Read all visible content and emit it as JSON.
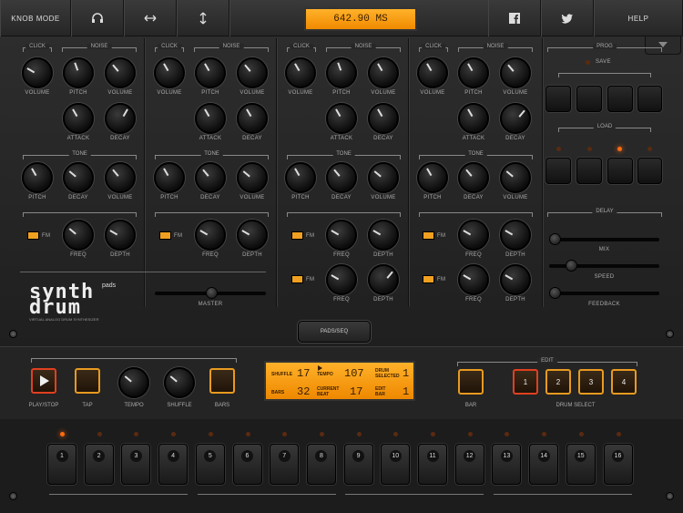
{
  "topbar": {
    "knob_mode": "KNOB MODE",
    "display": "642.90 MS",
    "help": "HELP"
  },
  "drum": {
    "click": "CLICK",
    "noise": "NOISE",
    "tone": "TONE",
    "volume": "VOLUME",
    "pitch": "PITCH",
    "attack": "ATTACK",
    "decay": "DECAY",
    "freq": "FREQ",
    "depth": "DEPTH",
    "fm": "FM"
  },
  "logo": {
    "brand_line1": "synth",
    "brand_line2": "drum",
    "pads": "pads",
    "tagline": "VIRTUAL ANALOG DRUM SYNTHESIZER"
  },
  "master": "MASTER",
  "pads_seq": "PADS/SEQ",
  "prog": {
    "title": "PROG",
    "save": "SAVE",
    "load": "LOAD"
  },
  "delay": {
    "title": "DELAY",
    "mix": "MIX",
    "speed": "SPEED",
    "feedback": "FEEDBACK"
  },
  "transport": {
    "play_stop": "PLAY/STOP",
    "tap": "TAP",
    "tempo": "TEMPO",
    "shuffle": "SHUFFLE",
    "bars": "BARS"
  },
  "lcd": {
    "shuffle_label": "SHUFFLE",
    "shuffle_value": "17",
    "tempo_label": "TEMPO",
    "tempo_value": "107",
    "drum_selected_label1": "DRUM",
    "drum_selected_label2": "SELECTED",
    "drum_selected_value": "1",
    "bars_label": "BARS",
    "bars_value": "32",
    "current_beat_label1": "CURRENT",
    "current_beat_label2": "BEAT",
    "current_beat_value": "17",
    "edit_bar_label1": "EDIT",
    "edit_bar_label2": "BAR",
    "edit_bar_value": "1"
  },
  "edit": {
    "title": "EDIT",
    "bar": "BAR",
    "drum_select": "DRUM SELECT",
    "drums": [
      "1",
      "2",
      "3",
      "4"
    ]
  },
  "steps": [
    "1",
    "2",
    "3",
    "4",
    "5",
    "6",
    "7",
    "8",
    "9",
    "10",
    "11",
    "12",
    "13",
    "14",
    "15",
    "16"
  ],
  "active_step": 1,
  "colors": {
    "accent": "#f08a00",
    "led_on": "#ff6a10"
  }
}
